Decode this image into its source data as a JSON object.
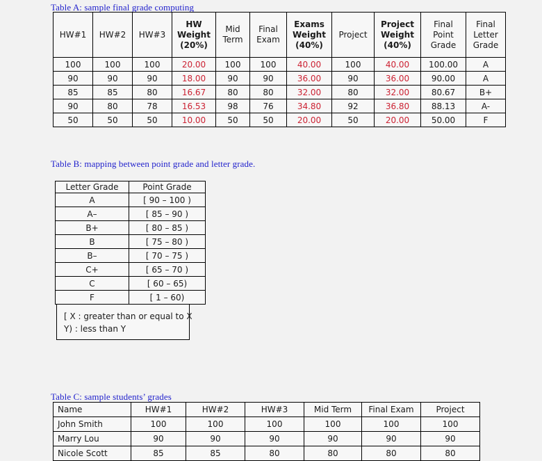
{
  "tables": {
    "a": {
      "caption": "Table A: sample final grade computing",
      "headers": [
        {
          "label": "HW#1",
          "bold": false
        },
        {
          "label": "HW#2",
          "bold": false
        },
        {
          "label": "HW#3",
          "bold": false
        },
        {
          "label": "HW Weight (20%)",
          "bold": true
        },
        {
          "label": "Mid Term",
          "bold": false
        },
        {
          "label": "Final Exam",
          "bold": false
        },
        {
          "label": "Exams Weight (40%)",
          "bold": true
        },
        {
          "label": "Project",
          "bold": false
        },
        {
          "label": "Project Weight (40%)",
          "bold": true
        },
        {
          "label": "Final Point Grade",
          "bold": false
        },
        {
          "label": "Final Letter Grade",
          "bold": false
        }
      ],
      "rows": [
        [
          "100",
          "100",
          "100",
          "20.00",
          "100",
          "100",
          "40.00",
          "100",
          "40.00",
          "100.00",
          "A"
        ],
        [
          "90",
          "90",
          "90",
          "18.00",
          "90",
          "90",
          "36.00",
          "90",
          "36.00",
          "90.00",
          "A"
        ],
        [
          "85",
          "85",
          "80",
          "16.67",
          "80",
          "80",
          "32.00",
          "80",
          "32.00",
          "80.67",
          "B+"
        ],
        [
          "90",
          "80",
          "78",
          "16.53",
          "98",
          "76",
          "34.80",
          "92",
          "36.80",
          "88.13",
          "A-"
        ],
        [
          "50",
          "50",
          "50",
          "10.00",
          "50",
          "50",
          "20.00",
          "50",
          "20.00",
          "50.00",
          "F"
        ]
      ],
      "red_columns": [
        3,
        6,
        8
      ]
    },
    "b": {
      "caption": "Table B:  mapping between point grade and letter grade.",
      "headers": [
        "Letter Grade",
        "Point Grade"
      ],
      "rows": [
        [
          "A",
          "[ 90 – 100 )"
        ],
        [
          "A–",
          "[ 85 – 90 )"
        ],
        [
          "B+",
          "[ 80 – 85 )"
        ],
        [
          "B",
          "[ 75 – 80 )"
        ],
        [
          "B–",
          "[ 70 – 75 )"
        ],
        [
          "C+",
          "[ 65 – 70 )"
        ],
        [
          "C",
          "[ 60 – 65)"
        ],
        [
          "F",
          "[ 1 – 60)"
        ]
      ],
      "legend": {
        "line1": "[ X : greater than or equal to X",
        "line2": "Y) : less than Y"
      }
    },
    "c": {
      "caption": "Table C: sample students’ grades",
      "headers": [
        "Name",
        "HW#1",
        "HW#2",
        "HW#3",
        "Mid Term",
        "Final Exam",
        "Project"
      ],
      "rows": [
        [
          "John Smith",
          "100",
          "100",
          "100",
          "100",
          "100",
          "100"
        ],
        [
          "Marry Lou",
          "90",
          "90",
          "90",
          "90",
          "90",
          "90"
        ],
        [
          "Nicole Scott",
          "85",
          "85",
          "80",
          "80",
          "80",
          "80"
        ]
      ]
    }
  },
  "colors": {
    "caption": "#2222cc",
    "computed_value": "#cc2233",
    "background": "#f2f2f2",
    "cell_background": "#f7f7f7",
    "border": "#000000"
  }
}
